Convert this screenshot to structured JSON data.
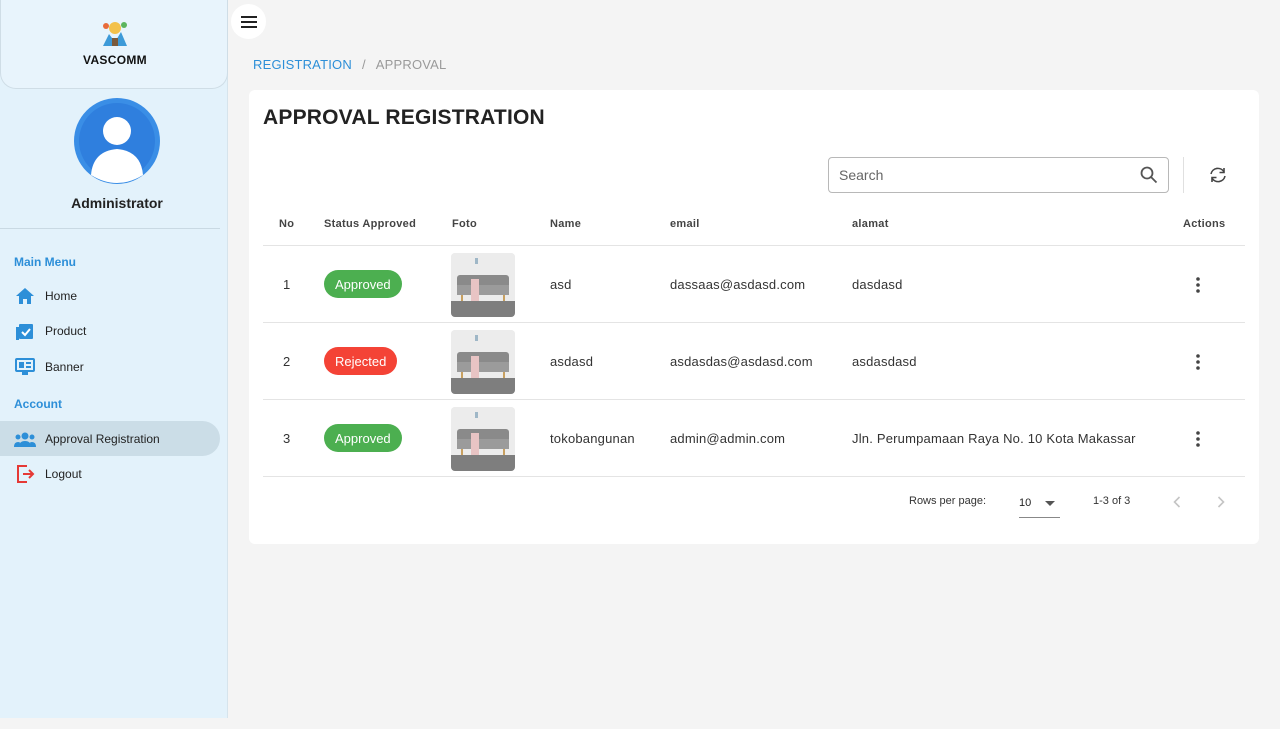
{
  "brand": {
    "name": "VASCOMM"
  },
  "user": {
    "name": "Administrator"
  },
  "sidebar": {
    "sections": [
      {
        "title": "Main Menu"
      },
      {
        "title": "Account"
      }
    ],
    "items": [
      {
        "label": "Home",
        "icon": "home-icon"
      },
      {
        "label": "Product",
        "icon": "clipboard-check-icon"
      },
      {
        "label": "Banner",
        "icon": "monitor-icon"
      },
      {
        "label": "Approval Registration",
        "icon": "users-icon",
        "active": true
      },
      {
        "label": "Logout",
        "icon": "logout-icon"
      }
    ]
  },
  "breadcrumb": {
    "link": "REGISTRATION",
    "separator": "/",
    "current": "APPROVAL"
  },
  "page": {
    "title": "APPROVAL REGISTRATION"
  },
  "search": {
    "placeholder": "Search",
    "value": ""
  },
  "table": {
    "columns": [
      "No",
      "Status Approved",
      "Foto",
      "Name",
      "email",
      "alamat",
      "Actions"
    ],
    "rows": [
      {
        "no": "1",
        "status": "Approved",
        "name": "asd",
        "email": "dassaas@asdasd.com",
        "alamat": "dasdasd"
      },
      {
        "no": "2",
        "status": "Rejected",
        "name": "asdasd",
        "email": "asdasdas@asdasd.com",
        "alamat": "asdasdasd"
      },
      {
        "no": "3",
        "status": "Approved",
        "name": "tokobangunan",
        "email": "admin@admin.com",
        "alamat": "Jln. Perumpamaan Raya No. 10 Kota Makassar"
      }
    ]
  },
  "pagination": {
    "rows_label": "Rows per page:",
    "rows_value": "10",
    "range": "1-3 of 3"
  },
  "colors": {
    "accent": "#2d8fd8",
    "approved": "#4caf50",
    "rejected": "#f44336",
    "sidebar_bg": "#e3f2fb"
  }
}
